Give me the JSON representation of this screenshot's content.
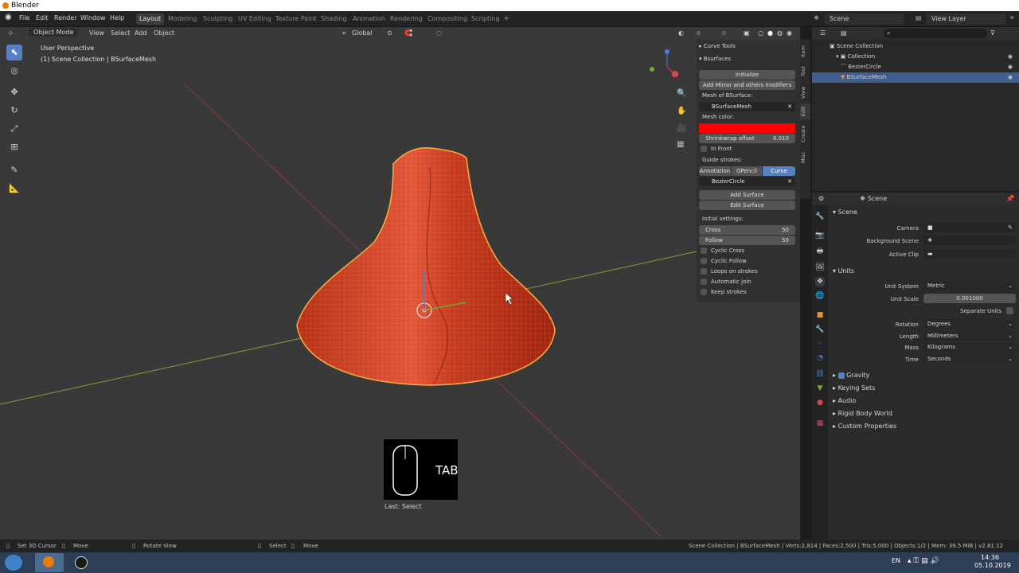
{
  "window": {
    "title": "Blender"
  },
  "menu": {
    "file": "File",
    "edit": "Edit",
    "render": "Render",
    "window": "Window",
    "help": "Help"
  },
  "workspaces": [
    "Layout",
    "Modeling",
    "Sculpting",
    "UV Editing",
    "Texture Paint",
    "Shading",
    "Animation",
    "Rendering",
    "Compositing",
    "Scripting"
  ],
  "topbar_right": {
    "scene": "Scene",
    "view_layer": "View Layer"
  },
  "viewport_header": {
    "mode": "Object Mode",
    "view": "View",
    "select": "Select",
    "add": "Add",
    "object": "Object",
    "orientation": "Global"
  },
  "viewport": {
    "perspective": "User Perspective",
    "collection": "(1) Scene Collection | BSurfaceMesh"
  },
  "keycast": {
    "key": "TAB",
    "last_op": "Last: Select"
  },
  "npanel": {
    "tabs": [
      "Item",
      "Tool",
      "View",
      "Edit",
      "Create",
      "Misc"
    ],
    "curve_tools": "Curve Tools",
    "bsurfaces": "Bsurfaces",
    "initialize": "Initialize",
    "add_mirror": "Add Mirror and others modifiers",
    "mesh_of_bsurface": "Mesh of BSurface:",
    "mesh_name": "BSurfaceMesh",
    "mesh_color": "Mesh color:",
    "mesh_color_value": "#ff0000",
    "shrinkwrap_label": "Shrinkwrap offset",
    "shrinkwrap_value": "0.010",
    "in_front": "In Front",
    "guide_strokes": "Guide strokes:",
    "guide_tabs": [
      "Annotation",
      "GPencil",
      "Curve"
    ],
    "guide_active": "Curve",
    "guide_curve": "BezierCircle",
    "add_surface": "Add Surface",
    "edit_surface": "Edit Surface",
    "initial_settings": "Initial settings:",
    "cross_label": "Cross",
    "cross_value": "50",
    "follow_label": "Follow",
    "follow_value": "50",
    "checks": [
      "Cyclic Cross",
      "Cyclic Follow",
      "Loops on strokes",
      "Automatic join",
      "Keep strokes"
    ]
  },
  "outliner": {
    "header": "Scene",
    "rows": [
      "Scene Collection",
      "Collection",
      "BezierCircle",
      "BSurfaceMesh"
    ]
  },
  "properties": {
    "header": "Scene",
    "section_scene": "Scene",
    "camera_label": "Camera",
    "background_scene_label": "Background Scene",
    "active_clip_label": "Active Clip",
    "section_units": "Units",
    "unit_system_label": "Unit System",
    "unit_system": "Metric",
    "unit_scale_label": "Unit Scale",
    "unit_scale": "0.001000",
    "separate_units": "Separate Units",
    "rotation_label": "Rotation",
    "rotation": "Degrees",
    "length_label": "Length",
    "length": "Millimeters",
    "mass_label": "Mass",
    "mass": "Kilograms",
    "time_label": "Time",
    "time": "Seconds",
    "collapsed": [
      "Gravity",
      "Keying Sets",
      "Audio",
      "Rigid Body World",
      "Custom Properties"
    ]
  },
  "statusbar": {
    "set_cursor": "Set 3D Cursor",
    "move": "Move",
    "rotate_view": "Rotate View",
    "select": "Select",
    "move2": "Move",
    "stats": "Scene Collection | BSurfaceMesh | Verts:2,814 | Faces:2,500 | Tris:5,000 | Objects:1/2 | Mem: 39.5 MiB | v2.81.12"
  },
  "taskbar": {
    "lang": "EN",
    "time": "14:36",
    "date": "05.10.2019"
  },
  "colors": {
    "accent": "#5680c2",
    "selected_row": "#3f5f8f",
    "mesh": "#d43a1c",
    "mesh_outline": "#ffae3b"
  }
}
